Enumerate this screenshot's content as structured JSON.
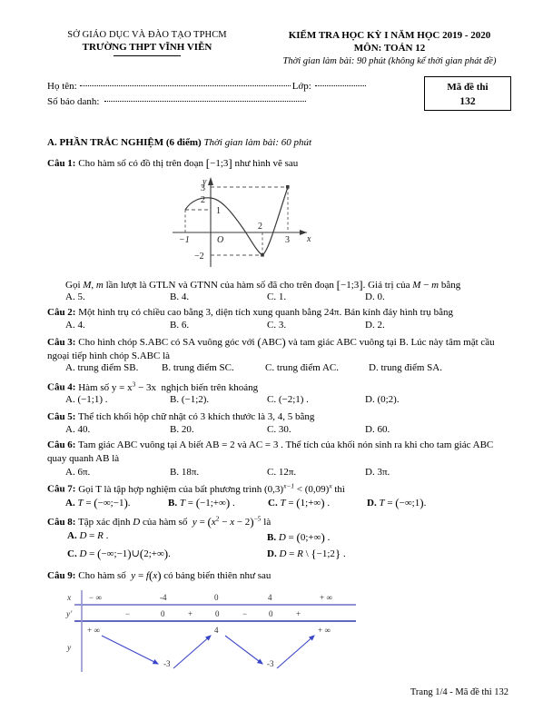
{
  "header": {
    "department": "SỞ GIÁO DỤC VÀ ĐÀO TẠO TPHCM",
    "school": "TRƯỜNG THPT VĨNH VIỄN",
    "exam_title": "KIỂM TRA HỌC KỲ I NĂM HỌC 2019 - 2020",
    "subject": "MÔN: TOÁN 12",
    "duration": "Thời gian làm bài: 90 phút (không kể thời gian phát đề)"
  },
  "identity": {
    "name_label": "Họ tên:",
    "class_label": "Lớp:",
    "sbd_label": "Số báo danh:",
    "code_title": "Mã đề thi",
    "code_value": "132"
  },
  "section_a": {
    "title": "A. PHẦN TRẮC NGHIỆM (6 điểm)",
    "note": "Thời gian làm bài: 60 phút"
  },
  "questions": [
    {
      "label": "Câu 1:",
      "text": "Cho hàm số có đồ thị trên đoạn [−1;3] như hình vẽ sau",
      "text2": "Gọi M, m lần lượt là GTLN và GTNN của hàm số đã cho trên đoạn [−1;3]. Giá trị của M − m bằng",
      "options": [
        "A. 5.",
        "B. 4.",
        "C. 1.",
        "D. 0."
      ]
    },
    {
      "label": "Câu 2:",
      "text": "Một hình trụ có chiều cao bằng 3, diện tích xung quanh bằng 24π. Bán kính đáy hình trụ bằng",
      "options": [
        "A. 4.",
        "B. 6.",
        "C. 3.",
        "D. 2."
      ]
    },
    {
      "label": "Câu 3:",
      "text": "Cho hình chóp S.ABC có SA vuông góc với (ABC) và tam giác ABC vuông tại B. Lúc này tâm mặt cầu ngoại tiếp hình chóp S.ABC là",
      "options": [
        "A. trung điểm SB.",
        "B. trung điểm SC.",
        "C. trung điểm AC.",
        "D. trung điểm SA."
      ]
    },
    {
      "label": "Câu 4:",
      "text": "Hàm số y = x³ − 3x  nghịch biến trên khoảng",
      "options": [
        "A. (−1;1) .",
        "B. (−1;2).",
        "C. (−2;1) .",
        "D. (0;2)."
      ]
    },
    {
      "label": "Câu 5:",
      "text": "Thể tích khối hộp chữ nhật có 3 khích thước là 3, 4, 5 bằng",
      "options": [
        "A. 40.",
        "B. 20.",
        "C. 30.",
        "D. 60."
      ]
    },
    {
      "label": "Câu 6:",
      "text": "Tam giác ABC vuông tại A biết AB = 2 và AC = 3 . Thể tích của khối nón sinh ra khi cho tam giác ABC quay quanh AB là",
      "options": [
        "A. 6π.",
        "B. 18π.",
        "C. 12π.",
        "D. 3π."
      ]
    },
    {
      "label": "Câu 7:",
      "text": "Gọi T là tập hợp nghiệm của bất phương trình (0,3)^(x−1) < (0,09)^x thì",
      "options": [
        "A. T = (−∞;−1) .",
        "B. T = (−1;+∞) .",
        "C. T = (1;+∞) .",
        "D. T = (−∞;1) ."
      ]
    },
    {
      "label": "Câu 8:",
      "text": "Tập xác định D của hàm số y = (x² − x − 2)^(−5) là",
      "options": [
        "A. D = R .",
        "B. D = (0;+∞) .",
        "C. D = (−∞;−1) ∪ (2;+∞).",
        "D. D = R \\ {−1;2} ."
      ]
    },
    {
      "label": "Câu 9:",
      "text": "Cho hàm số y = f(x) có bảng biến thiên như sau"
    }
  ],
  "graph": {
    "x_axis_label": "x",
    "y_axis_label": "y",
    "origin_label": "O",
    "x_ticks": [
      "−1",
      "2",
      "3"
    ],
    "y_ticks": [
      "3",
      "2",
      "1",
      "−2"
    ],
    "domain": [
      -1,
      3
    ],
    "max_value": 3,
    "min_value": -2,
    "max_at": 3,
    "min_at": 2
  },
  "variation_table": {
    "row_x_label": "x",
    "row_yp_label": "y'",
    "row_y_label": "y",
    "x_values": [
      "− ∞",
      "-4",
      "0",
      "4",
      "+ ∞"
    ],
    "yp_values": [
      "−",
      "0",
      "+",
      "0",
      "−",
      "0",
      "+"
    ],
    "y_values": [
      "+ ∞",
      "-3",
      "4",
      "-3",
      "+ ∞"
    ],
    "line_color": "#4a52b8"
  },
  "footer": {
    "text": "Trang 1/4 - Mã đề thi 132"
  }
}
